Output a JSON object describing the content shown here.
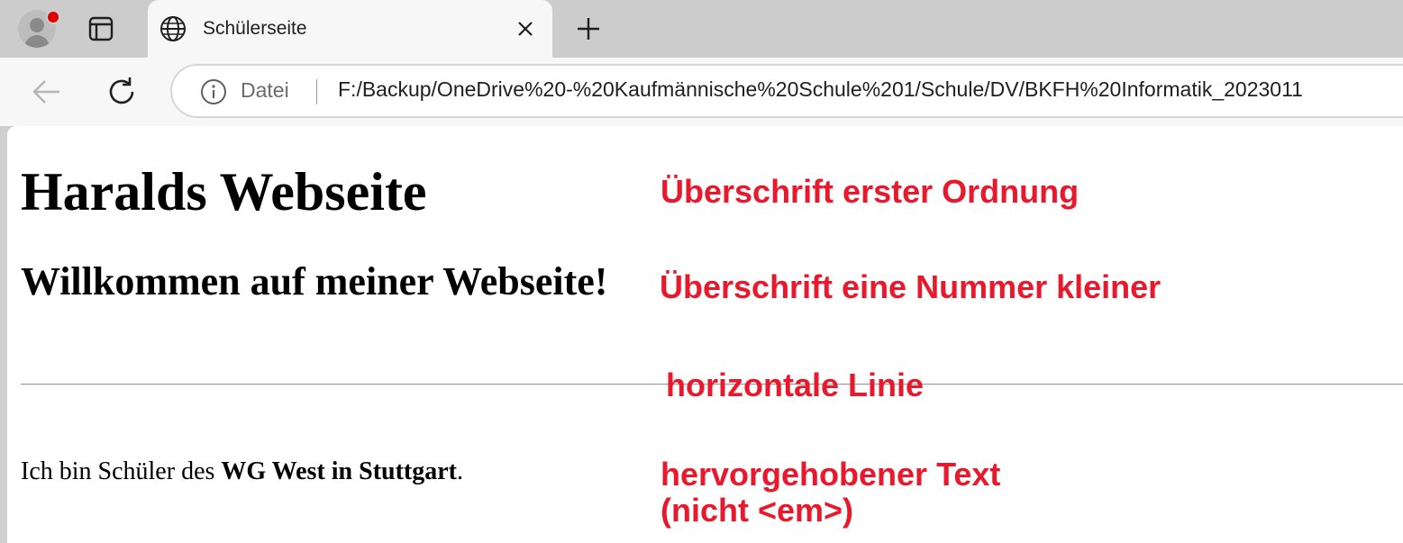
{
  "browser": {
    "tab": {
      "title": "Schülerseite"
    },
    "address_bar": {
      "security_chip": "Datei",
      "url": "F:/Backup/OneDrive%20-%20Kaufmännische%20Schule%201/Schule/DV/BKFH%20Informatik_2023011"
    },
    "icons": {
      "profile": "profile-avatar-icon",
      "tab_actions": "tab-actions-icon",
      "globe": "globe-icon",
      "close": "close-icon",
      "new_tab": "plus-icon",
      "back": "back-arrow-icon",
      "reload": "reload-icon",
      "info": "info-icon"
    },
    "colors": {
      "profile_notification": "#e00000"
    }
  },
  "page": {
    "heading1": "Haralds Webseite",
    "heading2": "Willkommen auf meiner Webseite!",
    "paragraph": {
      "before": "Ich bin Schüler des ",
      "bold": "WG West in Stuttgart",
      "after": "."
    }
  },
  "annotations": {
    "color": "#e8192c",
    "h1_note": "Überschrift erster Ordnung",
    "h2_note": "Überschrift eine Nummer kleiner",
    "hr_note": "horizontale Linie",
    "strong_note_line1": "hervorgehobener Text",
    "strong_note_line2": "(nicht <em>)"
  }
}
